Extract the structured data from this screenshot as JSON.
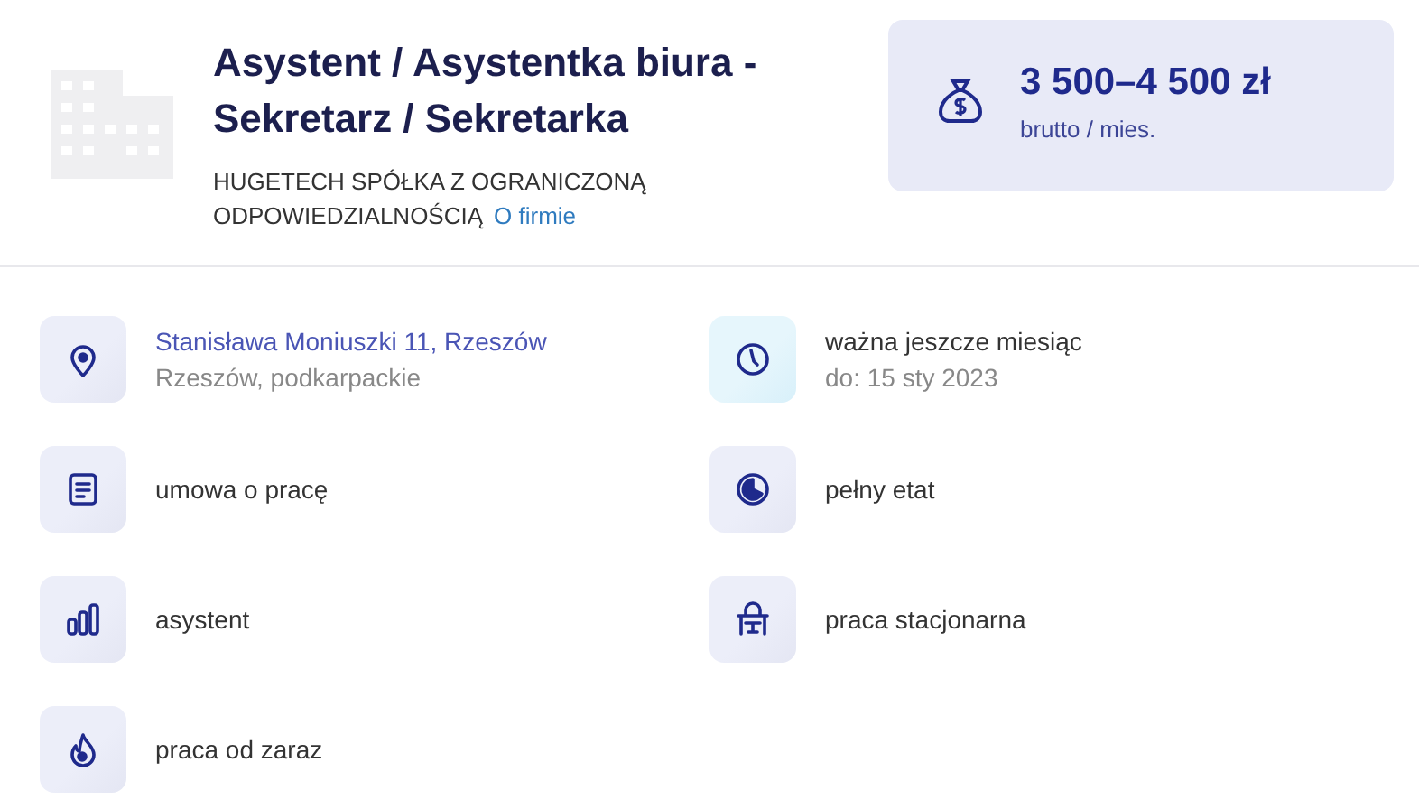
{
  "header": {
    "title_lines": [
      "Asystent / Asystentka biura -",
      "Sekretarz / Sekretarka"
    ],
    "company_lines": [
      "HUGETECH SPÓŁKA Z OGRANICZONĄ",
      "ODPOWIEDZIALNOŚCIĄ"
    ],
    "company_link": "O firmie"
  },
  "salary": {
    "amount": "3 500–4 500 zł",
    "period": "brutto / mies."
  },
  "details": [
    {
      "kind": "address",
      "text": "Stanisława Moniuszki 11, Rzeszów",
      "subtext": "Rzeszów, podkarpackie"
    },
    {
      "kind": "validity",
      "text": "ważna jeszcze miesiąc",
      "subtext": "do: 15 sty 2023"
    },
    {
      "kind": "contract",
      "text": "umowa o pracę"
    },
    {
      "kind": "schedule",
      "text": "pełny etat"
    },
    {
      "kind": "level",
      "text": "asystent"
    },
    {
      "kind": "workplace",
      "text": "praca stacjonarna"
    },
    {
      "kind": "start",
      "text": "praca od zaraz"
    }
  ]
}
